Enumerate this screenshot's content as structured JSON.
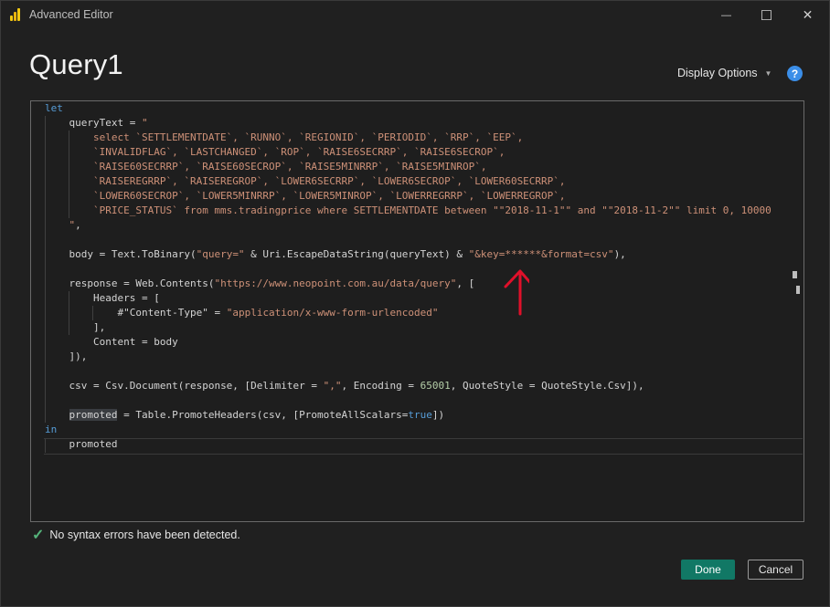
{
  "window": {
    "title": "Advanced Editor",
    "minimize_glyph": "—",
    "maximize_glyph": "☐",
    "close_glyph": "✕",
    "app_icon": "powerbi-icon"
  },
  "header": {
    "title": "Query1",
    "display_options_label": "Display Options",
    "help_label": "?"
  },
  "code": {
    "l1": "let",
    "l2a": "queryText = ",
    "l2b": "\"",
    "l3": "select `SETTLEMENTDATE`, `RUNNO`, `REGIONID`, `PERIODID`, `RRP`, `EEP`,",
    "l4": "`INVALIDFLAG`, `LASTCHANGED`, `ROP`, `RAISE6SECRRP`, `RAISE6SECROP`,",
    "l5": "`RAISE60SECRRP`, `RAISE60SECROP`, `RAISE5MINRRP`, `RAISE5MINROP`,",
    "l6": "`RAISEREGRRP`, `RAISEREGROP`, `LOWER6SECRRP`, `LOWER6SECROP`, `LOWER60SECRRP`,",
    "l7": "`LOWER60SECROP`, `LOWER5MINRRP`, `LOWER5MINROP`, `LOWERREGRRP`, `LOWERREGROP`,",
    "l8": "`PRICE_STATUS` from mms.tradingprice where SETTLEMENTDATE between \"\"2018-11-1\"\" and \"\"2018-11-2\"\" limit 0, 10000",
    "l9a": "\"",
    "l9b": ",",
    "l11a": "body = Text.ToBinary(",
    "l11b": "\"query=\"",
    "l11c": " & Uri.EscapeDataString(queryText) & ",
    "l11d": "\"&key=******&format=csv\"",
    "l11e": "),",
    "l13a": "response = Web.Contents(",
    "l13b": "\"https://www.neopoint.com.au/data/query\"",
    "l13c": ", [",
    "l14": "Headers = [",
    "l15a": "#\"Content-Type\" = ",
    "l15b": "\"application/x-www-form-urlencoded\"",
    "l16": "],",
    "l17": "Content = body",
    "l18": "]),",
    "l20a": "csv = Csv.Document(response, [Delimiter = ",
    "l20b": "\",\"",
    "l20c": ", Encoding = ",
    "l20d": "65001",
    "l20e": ", QuoteStyle = QuoteStyle.Csv]),",
    "l22a": "promoted",
    "l22b": " = Table.PromoteHeaders(csv, [PromoteAllScalars=",
    "l22c": "true",
    "l22d": "])",
    "l23": "in",
    "l24": "promoted"
  },
  "status": {
    "message": "No syntax errors have been detected."
  },
  "buttons": {
    "done": "Done",
    "cancel": "Cancel"
  },
  "colors": {
    "keyword": "#569cd6",
    "string": "#ce9178",
    "number": "#b5cea8",
    "done_button": "#117865",
    "annotation_arrow": "#e0102a"
  }
}
